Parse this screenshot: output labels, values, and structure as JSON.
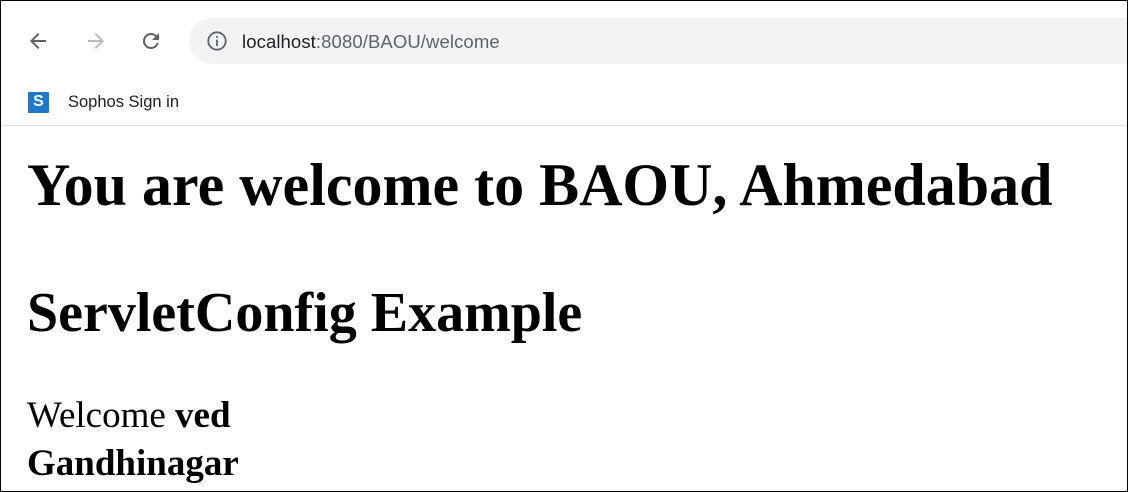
{
  "browser": {
    "url_host": "localhost",
    "url_rest": ":8080/BAOU/welcome",
    "icons": {
      "back": "arrow-left",
      "forward": "arrow-right",
      "reload": "reload",
      "site_info": "info-circle"
    }
  },
  "bookmarks": [
    {
      "icon_letter": "S",
      "label": "Sophos Sign in",
      "icon_color": "#1f78c8"
    }
  ],
  "page": {
    "heading1": "You are welcome to BAOU, Ahmedabad",
    "heading2": "ServletConfig Example",
    "welcome_prefix": "Welcome ",
    "welcome_name": "ved",
    "city": "Gandhinagar"
  }
}
